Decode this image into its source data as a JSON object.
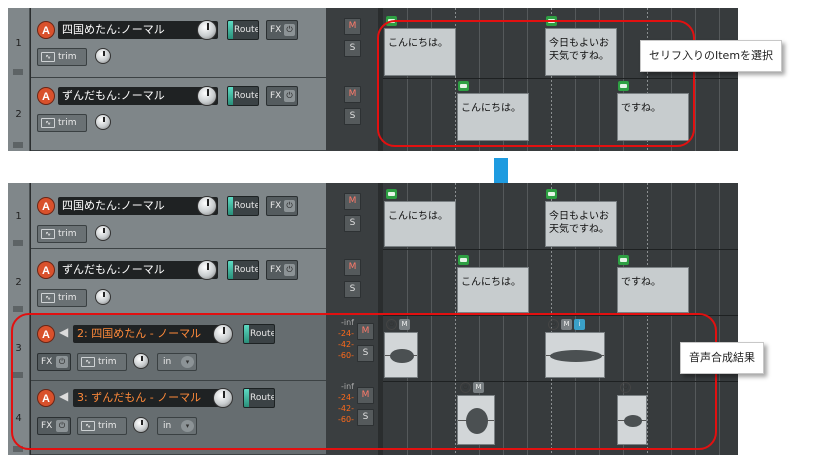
{
  "top": {
    "tracks": [
      {
        "number": "1",
        "name": "四国めたん:ノーマル",
        "route": "Route",
        "fx": "FX",
        "trim": "trim"
      },
      {
        "number": "2",
        "name": "ずんだもん:ノーマル",
        "route": "Route",
        "fx": "FX",
        "trim": "trim"
      }
    ],
    "items": [
      {
        "text": "こんにちは。"
      },
      {
        "text": "今日もよいお天気ですね。"
      },
      {
        "text": "こんにちは。"
      },
      {
        "text": "ですね。"
      }
    ],
    "callout": "セリフ入りのItemを選択"
  },
  "bottom": {
    "tracks": [
      {
        "number": "1",
        "name": "四国めたん:ノーマル",
        "route": "Route",
        "fx": "FX",
        "trim": "trim"
      },
      {
        "number": "2",
        "name": "ずんだもん:ノーマル",
        "route": "Route",
        "fx": "FX",
        "trim": "trim"
      },
      {
        "number": "3",
        "name": "2: 四国めたん - ノーマル",
        "route": "Route",
        "fx": "FX",
        "trim": "trim",
        "input": "in",
        "meter": [
          "-inf",
          "-24-",
          "-42-",
          "-60-"
        ]
      },
      {
        "number": "4",
        "name": "3: ずんだもん - ノーマル",
        "route": "Route",
        "fx": "FX",
        "trim": "trim",
        "input": "in",
        "meter": [
          "-inf",
          "-24-",
          "-42-",
          "-60-"
        ]
      }
    ],
    "items": [
      {
        "text": "こんにちは。"
      },
      {
        "text": "今日もよいお天気ですね。"
      },
      {
        "text": "こんにちは。"
      },
      {
        "text": "ですね。"
      }
    ],
    "callout": "音声合成結果"
  },
  "labels": {
    "arm": "A",
    "mute": "M",
    "solo": "S",
    "power": "⏻",
    "info": "i",
    "dropdown": "▾"
  },
  "colors": {
    "selected_track_name": "#ff8a3a",
    "highlight_border": "#e21010",
    "arrow": "#1e9be0",
    "item_flag": "#2ea043"
  }
}
